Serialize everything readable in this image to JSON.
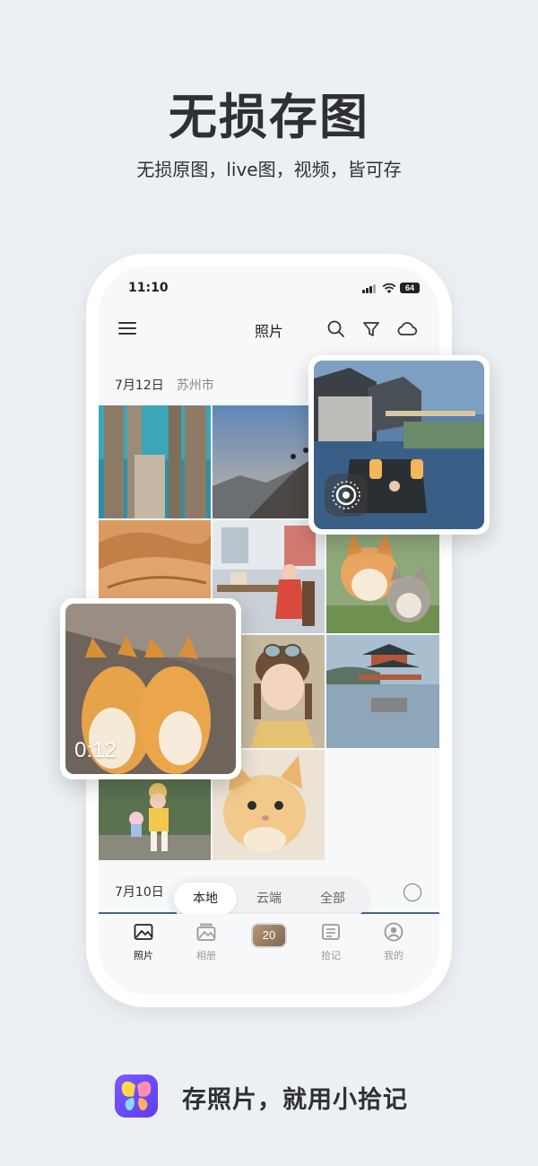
{
  "hero": {
    "title": "无损存图",
    "subtitle": "无损原图，live图，视频，皆可存"
  },
  "status_bar": {
    "time": "11:10",
    "battery": "64"
  },
  "app_bar": {
    "title": "照片",
    "icons": [
      "menu-icon",
      "search-icon",
      "filter-icon",
      "cloud-icon"
    ]
  },
  "sections": [
    {
      "date": "7月12日",
      "location": "苏州市"
    },
    {
      "date": "7月10日",
      "location": ""
    }
  ],
  "photos": [
    "pier-photo",
    "mountain-climber-photo",
    "desert-photo",
    "cafe-girl-photo",
    "corgi-cat-photo",
    "girl-with-goggles-photo",
    "lake-pavilion-photo",
    "child-toy-photo",
    "fluffy-cat-photo"
  ],
  "live_photo": {
    "badge": "live-icon"
  },
  "video": {
    "duration": "0:12"
  },
  "segmented_control": {
    "options": [
      "本地",
      "云端",
      "全部"
    ],
    "selected": "本地"
  },
  "tab_bar": {
    "items": [
      {
        "label": "照片",
        "icon": "photo-icon",
        "active": true
      },
      {
        "label": "相册",
        "icon": "album-icon",
        "active": false
      },
      {
        "label": "拾记",
        "icon": "note-icon",
        "active": false
      },
      {
        "label": "我的",
        "icon": "profile-icon",
        "active": false
      }
    ],
    "center_badge": "20"
  },
  "footer": {
    "slogan": "存照片，就用小拾记",
    "logo": "butterfly-logo"
  },
  "colors": {
    "background": "#edf0f3",
    "brand": "#6b4cf6"
  }
}
